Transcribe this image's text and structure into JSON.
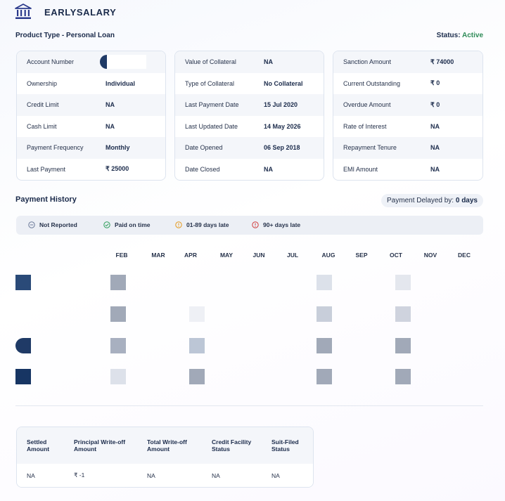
{
  "header": {
    "lender_name": "EARLYSALARY",
    "product_type": "Product Type - Personal Loan",
    "status_label": "Status:",
    "status_value": "Active",
    "status_color": "#2e8b57"
  },
  "details": {
    "card1": [
      {
        "label": "Account Number",
        "value": ""
      },
      {
        "label": "Ownership",
        "value": "Individual"
      },
      {
        "label": "Credit Limit",
        "value": "NA"
      },
      {
        "label": "Cash Limit",
        "value": "NA"
      },
      {
        "label": "Payment Frequency",
        "value": "Monthly"
      },
      {
        "label": "Last Payment",
        "value": "₹ 25000"
      }
    ],
    "card2": [
      {
        "label": "Value of Collateral",
        "value": "NA"
      },
      {
        "label": "Type of Collateral",
        "value": "No Collateral"
      },
      {
        "label": "Last Payment Date",
        "value": "15 Jul 2020"
      },
      {
        "label": "Last Updated Date",
        "value": "14 May 2026"
      },
      {
        "label": "Date Opened",
        "value": "06 Sep 2018"
      },
      {
        "label": "Date Closed",
        "value": "NA"
      }
    ],
    "card3": [
      {
        "label": "Sanction Amount",
        "value": "₹ 74000"
      },
      {
        "label": "Current Outstanding",
        "value": "₹ 0"
      },
      {
        "label": "Overdue Amount",
        "value": "₹ 0"
      },
      {
        "label": "Rate of Interest",
        "value": "NA"
      },
      {
        "label": "Repayment Tenure",
        "value": "NA"
      },
      {
        "label": "EMI Amount",
        "value": "NA"
      }
    ]
  },
  "payment_history": {
    "title": "Payment History",
    "delay_label": "Payment Delayed by:",
    "delay_value": "0 days",
    "legend": [
      {
        "label": "Not Reported",
        "icon": "minus-circle-icon",
        "color": "#6b7a99"
      },
      {
        "label": "Paid on time",
        "icon": "check-circle-icon",
        "color": "#2e9e5b"
      },
      {
        "label": "01-89 days late",
        "icon": "exclamation-circle-icon",
        "color": "#e69a1c"
      },
      {
        "label": "90+ days late",
        "icon": "exclamation-circle-icon",
        "color": "#d13b3b"
      }
    ],
    "months": [
      "FEB",
      "MAR",
      "APR",
      "MAY",
      "JUN",
      "JUL",
      "AUG",
      "SEP",
      "OCT",
      "NOV",
      "DEC"
    ],
    "year_colors": [
      "#2a4a78",
      "#ffffff",
      "#1f3a66",
      "#173563"
    ],
    "rows": [
      {
        "cells": [
          {
            "month": "FEB",
            "color": "#a1a9b8"
          },
          {
            "month": "AUG",
            "color": "#dce1ea"
          },
          {
            "month": "OCT",
            "color": "#e4e7ee"
          }
        ]
      },
      {
        "cells": [
          {
            "month": "FEB",
            "color": "#a1a9b8"
          },
          {
            "month": "APR",
            "color": "#eef0f5"
          },
          {
            "month": "AUG",
            "color": "#c8ceda"
          },
          {
            "month": "OCT",
            "color": "#cfd3de"
          }
        ]
      },
      {
        "cells": [
          {
            "month": "FEB",
            "color": "#a8b0c0"
          },
          {
            "month": "APR",
            "color": "#bcc6d6"
          },
          {
            "month": "AUG",
            "color": "#a1a9b8"
          },
          {
            "month": "OCT",
            "color": "#a1a9b8"
          }
        ]
      },
      {
        "cells": [
          {
            "month": "FEB",
            "color": "#dde1ea"
          },
          {
            "month": "APR",
            "color": "#a1a9b8"
          },
          {
            "month": "AUG",
            "color": "#a1a9b8"
          },
          {
            "month": "OCT",
            "color": "#a1a9b8"
          }
        ]
      }
    ]
  },
  "bottom_table": {
    "headers": [
      "Settled Amount",
      "Principal Write-off Amount",
      "Total Write-off Amount",
      "Credit Facility Status",
      "Suit-Filed Status"
    ],
    "values": [
      "NA",
      "₹ -1",
      "NA",
      "NA",
      "NA"
    ]
  }
}
